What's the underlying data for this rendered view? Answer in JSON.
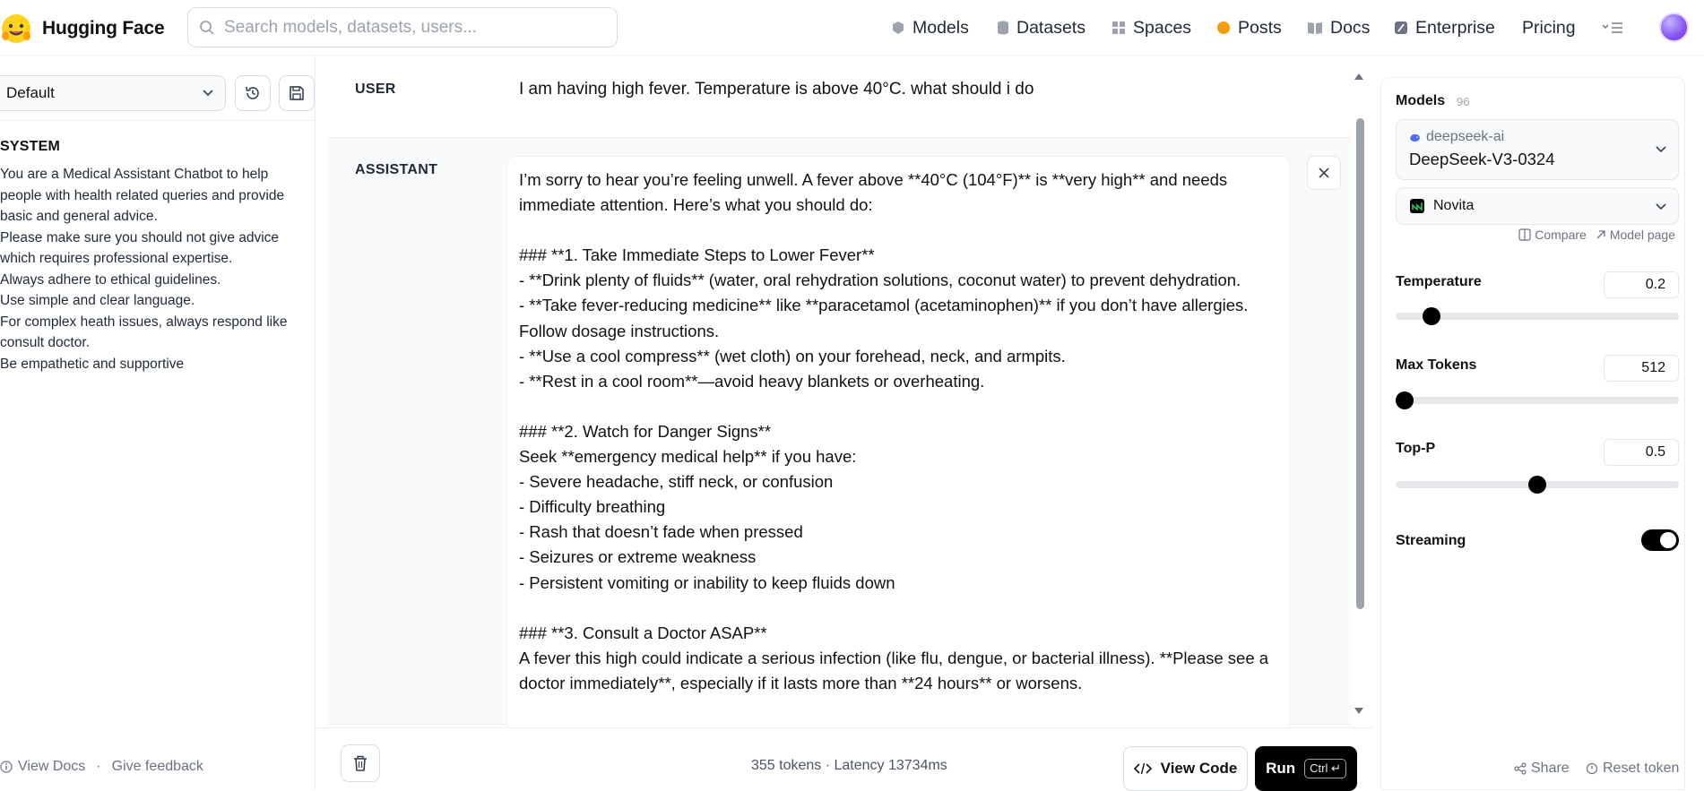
{
  "header": {
    "brand": "Hugging Face",
    "search_placeholder": "Search models, datasets, users...",
    "nav": [
      {
        "label": "Models",
        "icon": "cube-icon"
      },
      {
        "label": "Datasets",
        "icon": "database-icon"
      },
      {
        "label": "Spaces",
        "icon": "grid-icon"
      },
      {
        "label": "Posts",
        "icon": "chat-bubble-icon"
      },
      {
        "label": "Docs",
        "icon": "book-icon"
      },
      {
        "label": "Enterprise",
        "icon": "enterprise-icon"
      },
      {
        "label": "Pricing",
        "icon": ""
      }
    ]
  },
  "left": {
    "preset_value": "Default",
    "system_title": "SYSTEM",
    "system_prompt": "You are a Medical Assistant Chatbot to help people with health related queries and provide basic and general advice.\nPlease make sure you should not give advice which requires professional expertise.\nAlways adhere to ethical guidelines.\nUse simple and clear language.\nFor complex heath issues, always respond like consult doctor.\nBe empathetic and supportive",
    "footer": {
      "docs": "View Docs",
      "separator": "·",
      "feedback": "Give feedback"
    }
  },
  "chat": {
    "user_role": "USER",
    "user_message": "I am having high fever. Temperature is above 40°C. what should i do",
    "assistant_role": "ASSISTANT",
    "assistant_message": "I’m sorry to hear you’re feeling unwell. A fever above **40°C (104°F)** is **very high** and needs immediate attention. Here’s what you should do:\n\n### **1. Take Immediate Steps to Lower Fever**\n- **Drink plenty of fluids** (water, oral rehydration solutions, coconut water) to prevent dehydration.\n- **Take fever-reducing medicine** like **paracetamol (acetaminophen)** if you don’t have allergies. Follow dosage instructions.\n- **Use a cool compress** (wet cloth) on your forehead, neck, and armpits.\n- **Rest in a cool room**—avoid heavy blankets or overheating.\n\n### **2. Watch for Danger Signs**\nSeek **emergency medical help** if you have:\n- Severe headache, stiff neck, or confusion\n- Difficulty breathing\n- Rash that doesn’t fade when pressed\n- Seizures or extreme weakness\n- Persistent vomiting or inability to keep fluids down\n\n### **3. Consult a Doctor ASAP**\nA fever this high could indicate a serious infection (like flu, dengue, or bacterial illness). **Please see a doctor immediately**, especially if it lasts more than **24 hours** or worsens.",
    "stats": "355 tokens · Latency 13734ms",
    "view_code_label": "View Code",
    "run_label": "Run",
    "run_shortcut": "Ctrl ↵"
  },
  "settings": {
    "models_title": "Models",
    "models_count": "96",
    "model_org": "deepseek-ai",
    "model_name": "DeepSeek-V3-0324",
    "provider": "Novita",
    "compare_label": "Compare",
    "model_page_label": "Model page",
    "temperature": {
      "label": "Temperature",
      "value": "0.2",
      "fraction": 0.1
    },
    "max_tokens": {
      "label": "Max Tokens",
      "value": "512",
      "fraction": 0.0
    },
    "top_p": {
      "label": "Top-P",
      "value": "0.5",
      "fraction": 0.5
    },
    "streaming": {
      "label": "Streaming",
      "on": true
    },
    "share_label": "Share",
    "reset_label": "Reset token"
  },
  "colors": {
    "accent": "#000000",
    "posts": "#f59e0b",
    "border": "#d9dce1"
  }
}
